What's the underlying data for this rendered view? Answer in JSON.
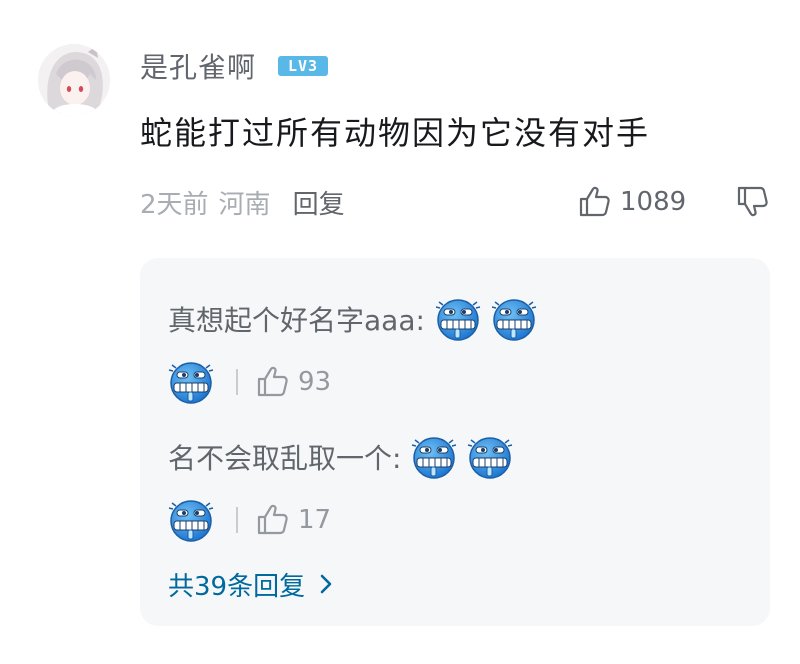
{
  "comment": {
    "username": "是孔雀啊",
    "level": "LV3",
    "text": "蛇能打过所有动物因为它没有对手",
    "time": "2天前",
    "location": "河南",
    "reply_label": "回复",
    "like_count": "1089"
  },
  "replies": [
    {
      "text": "真想起个好名字aaa:",
      "emoji": "sneer-emoji",
      "like_count": "93"
    },
    {
      "text": "名不会取乱取一个:",
      "emoji": "sneer-emoji",
      "like_count": "17"
    }
  ],
  "more_replies": {
    "label": "共39条回复"
  },
  "colors": {
    "emoji_blue": "#2f8fe0",
    "level_badge": "#5ab8e8",
    "link": "#00699d"
  }
}
